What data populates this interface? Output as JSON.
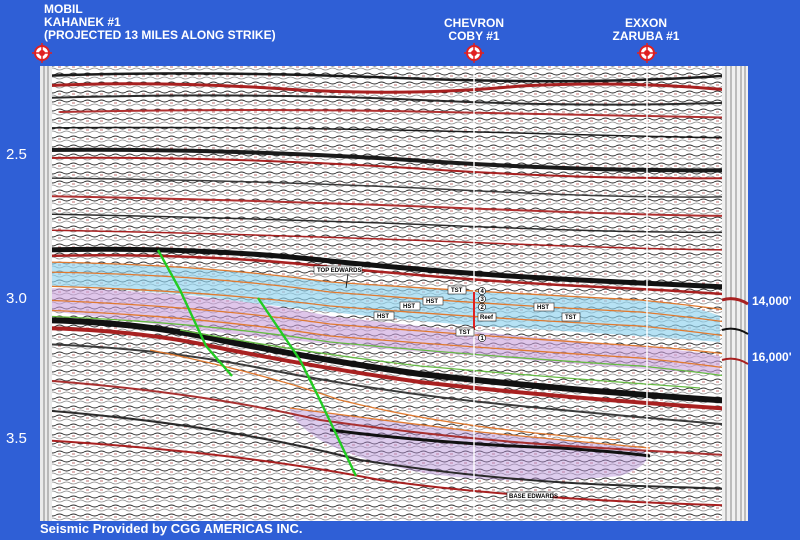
{
  "wells": [
    {
      "name_line1": "MOBIL",
      "name_line2": "KAHANEK #1",
      "note": "(PROJECTED 13 MILES ALONG STRIKE)",
      "icon": "well-symbol-icon"
    },
    {
      "name_line1": "CHEVRON",
      "name_line2": "COBY #1",
      "icon": "well-symbol-icon"
    },
    {
      "name_line1": "EXXON",
      "name_line2": "ZARUBA #1",
      "icon": "well-symbol-icon"
    }
  ],
  "time_axis": {
    "ticks": [
      "2.5",
      "3.0",
      "3.5"
    ]
  },
  "depth_labels": [
    "14,000'",
    "16,000'"
  ],
  "annotations": {
    "top_edwards": "TOP EDWARDS",
    "base_edwards": "BASE EDWARDS",
    "hst": "HST",
    "tst": "TST",
    "reef": "Reef",
    "markers": [
      "4",
      "3",
      "2",
      "1"
    ]
  },
  "credit": "Seismic Provided by CGG AMERICAS INC.",
  "colors": {
    "background": "#2f5fd6",
    "fault": "#22cc22",
    "well_symbol": "#e02020",
    "horizon": "#e07a30",
    "seismic_red": "#b82020",
    "hst_fill": "#8fd3ee",
    "tst_fill": "#c9a0dc"
  }
}
